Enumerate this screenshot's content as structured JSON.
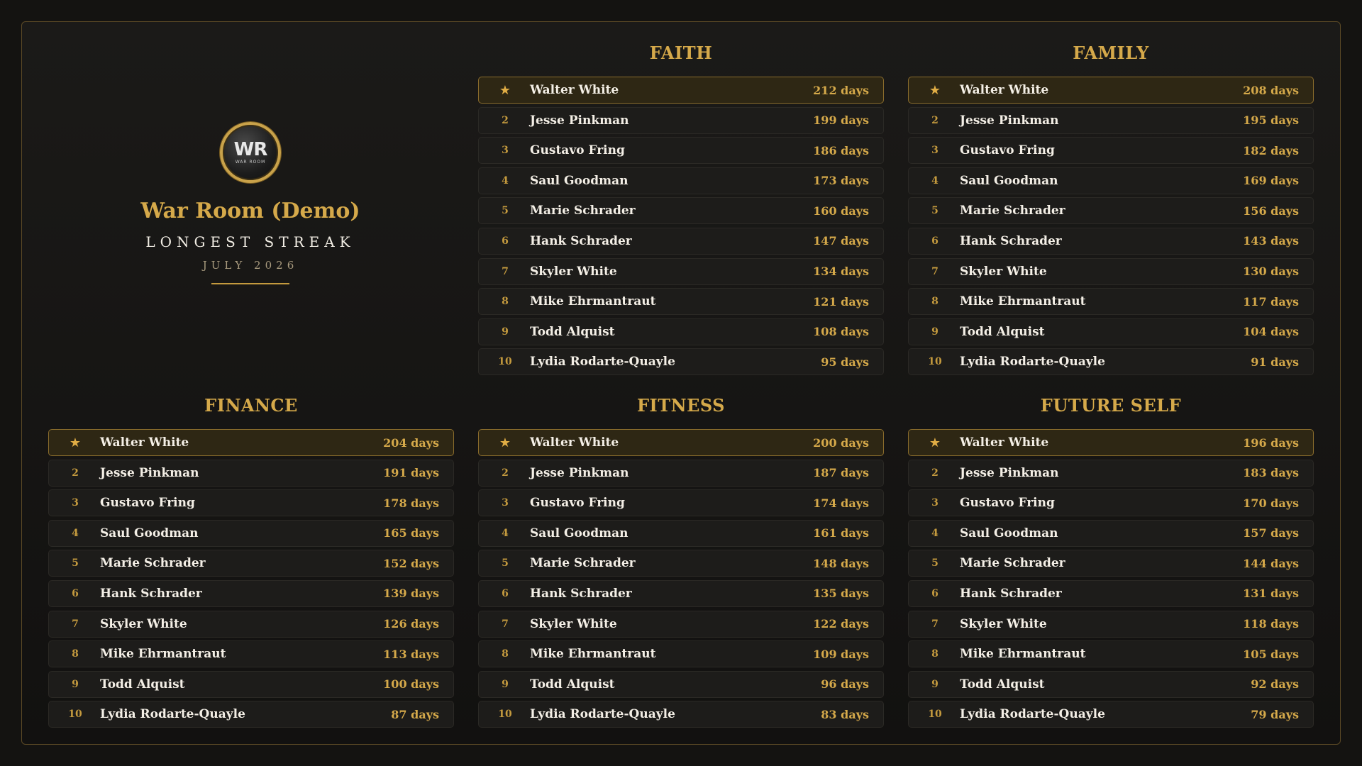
{
  "brand": {
    "logo_mark": "WR",
    "logo_sub": "WAR ROOM",
    "title": "War Room (Demo)",
    "subtitle": "LONGEST STREAK",
    "period": "JULY 2026"
  },
  "colors": {
    "accent": "#d5a94a",
    "background": "#141311",
    "row": "#1d1c1a",
    "highlight_row": "#2e2714"
  },
  "top_icon": "star-icon",
  "panels": [
    {
      "title": "FAITH",
      "entries": [
        {
          "rank": "",
          "name": "Walter White",
          "streak": "212 days"
        },
        {
          "rank": "2",
          "name": "Jesse Pinkman",
          "streak": "199 days"
        },
        {
          "rank": "3",
          "name": "Gustavo Fring",
          "streak": "186 days"
        },
        {
          "rank": "4",
          "name": "Saul Goodman",
          "streak": "173 days"
        },
        {
          "rank": "5",
          "name": "Marie Schrader",
          "streak": "160 days"
        },
        {
          "rank": "6",
          "name": "Hank Schrader",
          "streak": "147 days"
        },
        {
          "rank": "7",
          "name": "Skyler White",
          "streak": "134 days"
        },
        {
          "rank": "8",
          "name": "Mike Ehrmantraut",
          "streak": "121 days"
        },
        {
          "rank": "9",
          "name": "Todd Alquist",
          "streak": "108 days"
        },
        {
          "rank": "10",
          "name": "Lydia Rodarte-Quayle",
          "streak": "95 days"
        }
      ]
    },
    {
      "title": "FAMILY",
      "entries": [
        {
          "rank": "",
          "name": "Walter White",
          "streak": "208 days"
        },
        {
          "rank": "2",
          "name": "Jesse Pinkman",
          "streak": "195 days"
        },
        {
          "rank": "3",
          "name": "Gustavo Fring",
          "streak": "182 days"
        },
        {
          "rank": "4",
          "name": "Saul Goodman",
          "streak": "169 days"
        },
        {
          "rank": "5",
          "name": "Marie Schrader",
          "streak": "156 days"
        },
        {
          "rank": "6",
          "name": "Hank Schrader",
          "streak": "143 days"
        },
        {
          "rank": "7",
          "name": "Skyler White",
          "streak": "130 days"
        },
        {
          "rank": "8",
          "name": "Mike Ehrmantraut",
          "streak": "117 days"
        },
        {
          "rank": "9",
          "name": "Todd Alquist",
          "streak": "104 days"
        },
        {
          "rank": "10",
          "name": "Lydia Rodarte-Quayle",
          "streak": "91 days"
        }
      ]
    },
    {
      "title": "FINANCE",
      "entries": [
        {
          "rank": "",
          "name": "Walter White",
          "streak": "204 days"
        },
        {
          "rank": "2",
          "name": "Jesse Pinkman",
          "streak": "191 days"
        },
        {
          "rank": "3",
          "name": "Gustavo Fring",
          "streak": "178 days"
        },
        {
          "rank": "4",
          "name": "Saul Goodman",
          "streak": "165 days"
        },
        {
          "rank": "5",
          "name": "Marie Schrader",
          "streak": "152 days"
        },
        {
          "rank": "6",
          "name": "Hank Schrader",
          "streak": "139 days"
        },
        {
          "rank": "7",
          "name": "Skyler White",
          "streak": "126 days"
        },
        {
          "rank": "8",
          "name": "Mike Ehrmantraut",
          "streak": "113 days"
        },
        {
          "rank": "9",
          "name": "Todd Alquist",
          "streak": "100 days"
        },
        {
          "rank": "10",
          "name": "Lydia Rodarte-Quayle",
          "streak": "87 days"
        }
      ]
    },
    {
      "title": "FITNESS",
      "entries": [
        {
          "rank": "",
          "name": "Walter White",
          "streak": "200 days"
        },
        {
          "rank": "2",
          "name": "Jesse Pinkman",
          "streak": "187 days"
        },
        {
          "rank": "3",
          "name": "Gustavo Fring",
          "streak": "174 days"
        },
        {
          "rank": "4",
          "name": "Saul Goodman",
          "streak": "161 days"
        },
        {
          "rank": "5",
          "name": "Marie Schrader",
          "streak": "148 days"
        },
        {
          "rank": "6",
          "name": "Hank Schrader",
          "streak": "135 days"
        },
        {
          "rank": "7",
          "name": "Skyler White",
          "streak": "122 days"
        },
        {
          "rank": "8",
          "name": "Mike Ehrmantraut",
          "streak": "109 days"
        },
        {
          "rank": "9",
          "name": "Todd Alquist",
          "streak": "96 days"
        },
        {
          "rank": "10",
          "name": "Lydia Rodarte-Quayle",
          "streak": "83 days"
        }
      ]
    },
    {
      "title": "FUTURE SELF",
      "entries": [
        {
          "rank": "",
          "name": "Walter White",
          "streak": "196 days"
        },
        {
          "rank": "2",
          "name": "Jesse Pinkman",
          "streak": "183 days"
        },
        {
          "rank": "3",
          "name": "Gustavo Fring",
          "streak": "170 days"
        },
        {
          "rank": "4",
          "name": "Saul Goodman",
          "streak": "157 days"
        },
        {
          "rank": "5",
          "name": "Marie Schrader",
          "streak": "144 days"
        },
        {
          "rank": "6",
          "name": "Hank Schrader",
          "streak": "131 days"
        },
        {
          "rank": "7",
          "name": "Skyler White",
          "streak": "118 days"
        },
        {
          "rank": "8",
          "name": "Mike Ehrmantraut",
          "streak": "105 days"
        },
        {
          "rank": "9",
          "name": "Todd Alquist",
          "streak": "92 days"
        },
        {
          "rank": "10",
          "name": "Lydia Rodarte-Quayle",
          "streak": "79 days"
        }
      ]
    }
  ]
}
